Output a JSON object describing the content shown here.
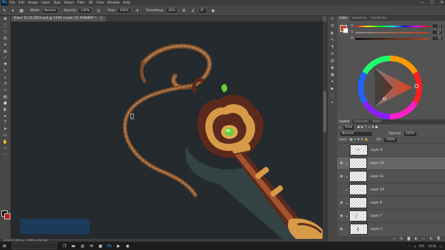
{
  "app": {
    "logo": "Ps"
  },
  "menu": [
    "File",
    "Edit",
    "Image",
    "Layer",
    "Type",
    "Select",
    "Filter",
    "3D",
    "View",
    "Window",
    "Help"
  ],
  "window_controls": {
    "minimize": "—",
    "maximize": "☐",
    "close": "✕"
  },
  "options_bar": {
    "mode_label": "Mode:",
    "mode_value": "Normal",
    "opacity_label": "Opacity:",
    "opacity_value": "100%",
    "flow_label": "Flow:",
    "flow_value": "100%",
    "smoothing_label": "Smoothing:",
    "smoothing_value": "10%",
    "angle_value": "0°"
  },
  "document_tab": {
    "title": "Ключ 12.05.2021.psd @ 133% (Layer 12, RGB/8#) *",
    "close": "×"
  },
  "status_bar": {
    "text": "133,29%   1920 px x 1080 px (96 ppi)"
  },
  "tools": [
    "move-tool",
    "marquee-tool",
    "lasso-tool",
    "magic-wand-tool",
    "crop-tool",
    "frame-tool",
    "eyedropper-tool",
    "healing-tool",
    "brush-tool",
    "stamp-tool",
    "history-brush-tool",
    "eraser-tool",
    "gradient-tool",
    "blur-tool",
    "dodge-tool",
    "pen-tool",
    "type-tool",
    "path-select-tool",
    "shape-tool",
    "hand-tool",
    "zoom-tool",
    "edit-toolbar"
  ],
  "color_panel": {
    "tabs": [
      "Color",
      "Swatches",
      "Gradients"
    ],
    "active_tab": "Color",
    "sliders": [
      {
        "label": "H",
        "value": "13"
      },
      {
        "label": "S",
        "value": "87"
      },
      {
        "label": "B",
        "value": "76"
      }
    ],
    "selected_color": "#c2441b"
  },
  "layers_panel": {
    "tabs": [
      "Layers",
      "Channels",
      "Paths"
    ],
    "active_tab": "Layers",
    "filter_label": "Kind",
    "blend_mode": "Normal",
    "opacity_label": "Opacity:",
    "opacity_value": "100%",
    "lock_label": "Lock:",
    "fill_label": "Fill:",
    "fill_value": "100%",
    "layers": [
      {
        "name": "Layer 4",
        "visible": false,
        "selected": false
      },
      {
        "name": "Layer 12",
        "visible": true,
        "selected": true
      },
      {
        "name": "Layer 11",
        "visible": true,
        "selected": false
      },
      {
        "name": "Layer 10",
        "visible": false,
        "selected": false
      },
      {
        "name": "Layer 8",
        "visible": true,
        "selected": false
      },
      {
        "name": "Layer 7",
        "visible": true,
        "selected": false
      },
      {
        "name": "Layer 5",
        "visible": true,
        "selected": false
      }
    ]
  },
  "taskbar": {
    "search_placeholder": "",
    "tray_lang": "РУС",
    "tray_time": "19:34"
  },
  "colors": {
    "canvas_bg": "#242a2d",
    "rope": "#8a5a34",
    "key_brown": "#5c2a1c",
    "gold": "#d79a48",
    "gem": "#6bd136"
  }
}
